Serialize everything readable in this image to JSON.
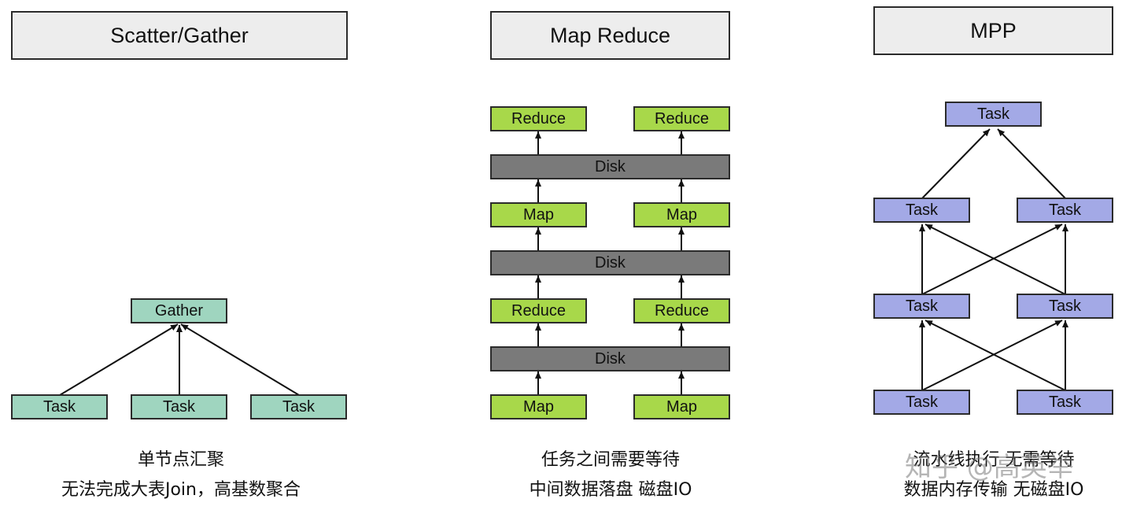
{
  "scatter_gather": {
    "title": "Scatter/Gather",
    "gather": "Gather",
    "tasks": [
      "Task",
      "Task",
      "Task"
    ],
    "caption_line1": "单节点汇聚",
    "caption_line2": "无法完成大表Join，高基数聚合"
  },
  "map_reduce": {
    "title": "Map Reduce",
    "reduce_top": [
      "Reduce",
      "Reduce"
    ],
    "disk_top": "Disk",
    "map_middle": [
      "Map",
      "Map"
    ],
    "disk_middle": "Disk",
    "reduce_middle": [
      "Reduce",
      "Reduce"
    ],
    "disk_bottom": "Disk",
    "map_bottom": [
      "Map",
      "Map"
    ],
    "caption_line1": "任务之间需要等待",
    "caption_line2": "中间数据落盘 磁盘IO"
  },
  "mpp": {
    "title": "MPP",
    "top": "Task",
    "row2": [
      "Task",
      "Task"
    ],
    "row3": [
      "Task",
      "Task"
    ],
    "row4": [
      "Task",
      "Task"
    ],
    "caption_line1": "流水线执行 无需等待",
    "caption_line2": "数据内存传输 无磁盘IO"
  },
  "watermark": "知乎 @高英举",
  "colors": {
    "gather_fill": "#9fd5bf",
    "mapreduce_fill": "#a8d84a",
    "disk_fill": "#7a7a7a",
    "mpp_fill": "#a3a9e6",
    "title_fill": "#ededed"
  }
}
